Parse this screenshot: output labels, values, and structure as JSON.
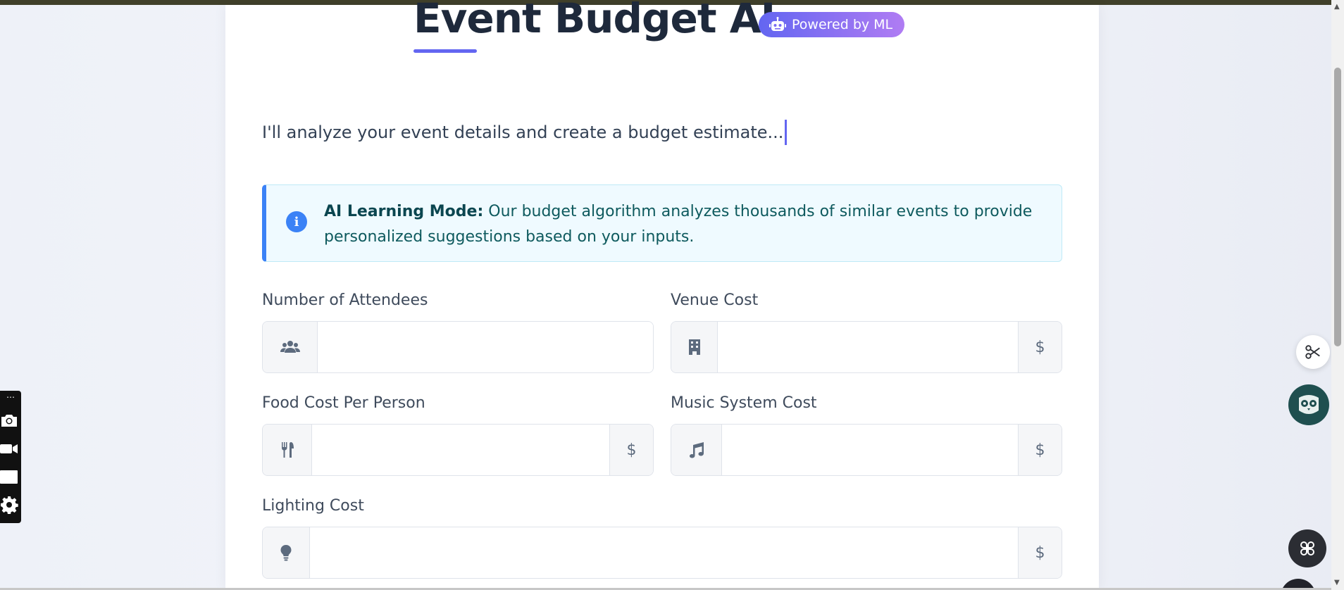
{
  "header": {
    "title": "Event Budget AI",
    "badge": "Powered by ML"
  },
  "intro": {
    "typing_text": "I'll analyze your event details and create a budget estimate..."
  },
  "info": {
    "heading": "AI Learning Mode:",
    "body": "Our budget algorithm analyzes thousands of similar events to provide personalized suggestions based on your inputs."
  },
  "form": {
    "attendees": {
      "label": "Number of Attendees",
      "value": ""
    },
    "venue": {
      "label": "Venue Cost",
      "value": "",
      "suffix": "$"
    },
    "food": {
      "label": "Food Cost Per Person",
      "value": "",
      "suffix": "$"
    },
    "music": {
      "label": "Music System Cost",
      "value": "",
      "suffix": "$"
    },
    "lighting": {
      "label": "Lighting Cost",
      "value": "",
      "suffix": "$"
    }
  },
  "colors": {
    "accent": "#6366f1",
    "info_border": "#3b82f6",
    "info_bg": "#effaff"
  },
  "icons": {
    "badge": "robot-icon",
    "info": "info-circle-icon",
    "attendees": "users-icon",
    "venue": "building-icon",
    "food": "utensils-icon",
    "music": "music-note-icon",
    "lighting": "lightbulb-icon"
  }
}
